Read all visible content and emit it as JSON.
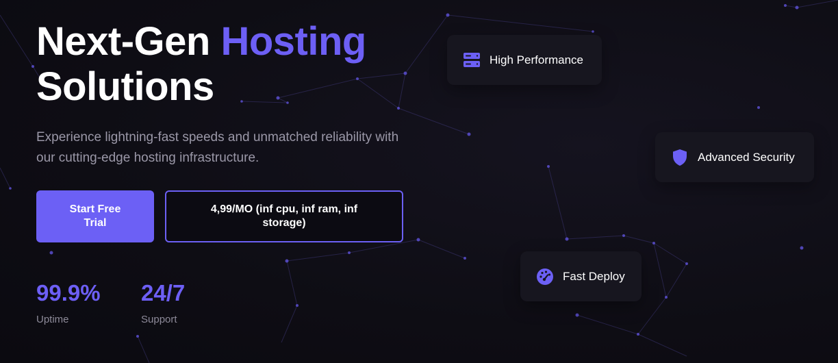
{
  "hero": {
    "headline_line1_plain": "Next-Gen ",
    "headline_line1_accent": "Hosting",
    "headline_line2": "Solutions",
    "subtitle": "Experience lightning-fast speeds and unmatched reliability with our cutting-edge hosting infrastructure."
  },
  "buttons": {
    "primary_label": "Start Free Trial",
    "secondary_label": "4,99/MO (inf cpu, inf ram, inf storage)"
  },
  "stats": [
    {
      "value": "99.9%",
      "label": "Uptime"
    },
    {
      "value": "24/7",
      "label": "Support"
    }
  ],
  "features": [
    {
      "label": "High Performance",
      "icon": "server-icon"
    },
    {
      "label": "Advanced Security",
      "icon": "shield-icon"
    },
    {
      "label": "Fast Deploy",
      "icon": "speedometer-icon"
    }
  ],
  "colors": {
    "background": "#0e0d14",
    "accent": "#6c60f5",
    "card": "#17161f",
    "muted_text": "#9b98a8"
  }
}
